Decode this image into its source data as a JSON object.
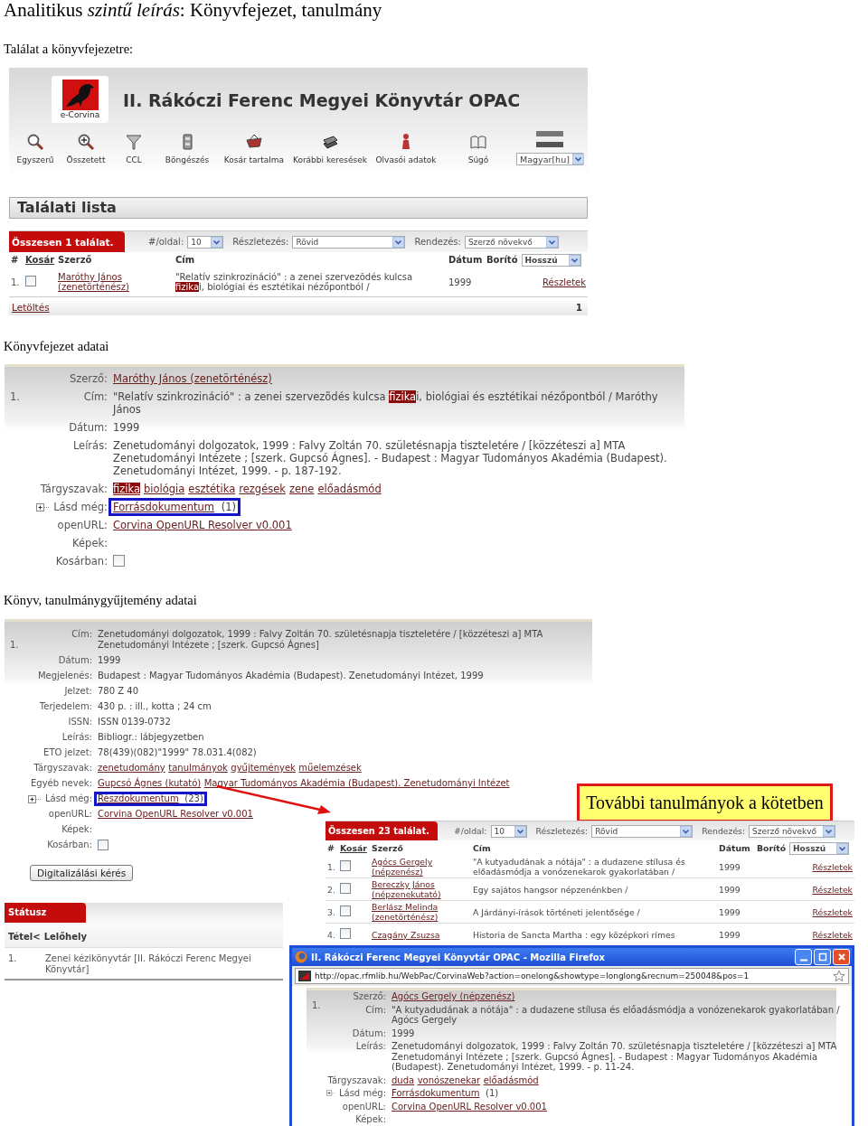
{
  "heading": "Analitikus *szintű leírás*: Könyvfejezet, tanulmány",
  "caption_1": "Találat a könyvfejezetre:",
  "opac": {
    "logo_text": "e-Corvina",
    "title": "II. Rákóczi Ferenc Megyei Könyvtár OPAC",
    "nav": [
      {
        "label": "Egyszerű"
      },
      {
        "label": "Összetett"
      },
      {
        "label": "CCL"
      },
      {
        "label": "Böngészés"
      },
      {
        "label": "Kosár tartalma"
      },
      {
        "label": "Korábbi keresések"
      },
      {
        "label": "Olvasói adatok"
      },
      {
        "label": "Súgó"
      }
    ],
    "language": "Magyar[hu]",
    "results_title": "Találati lista"
  },
  "results_1": {
    "summary": "Összesen 1 találat.",
    "per_page_label": "#/oldal:",
    "per_page": "10",
    "detail_label": "Részletezés:",
    "detail": "Rövid",
    "sort_label": "Rendezés:",
    "sort": "Szerző növekvő",
    "columns": [
      {
        "label": "#",
        "link": false
      },
      {
        "label": "Kosár",
        "link": true
      },
      {
        "label": "Szerző",
        "link": false
      },
      {
        "label": "Cím",
        "link": false
      },
      {
        "label": "Dátum",
        "link": false
      },
      {
        "label": "Borító",
        "link": false
      }
    ],
    "cover": "Hosszú",
    "rows": [
      {
        "number": "1.",
        "checked": false,
        "author": "Maróthy János (zenetörténész)",
        "title": [
          {
            "text": "\"Relatív szinkrozináció\" : a zenei szervezõdés kulcsa ",
            "highlight": false
          },
          {
            "text": "fizika",
            "highlight": true
          },
          {
            "text": "i, biológiai és esztétikai nézőpontból /",
            "highlight": false
          }
        ],
        "date": "1999",
        "details": "Részletek"
      }
    ],
    "footer": {
      "download": "Letöltés",
      "page": "1"
    }
  },
  "caption_2": "Könyvfejezet adatai",
  "record_1": {
    "number": "1.",
    "fields": [
      {
        "label": "Szerző:",
        "kind": "link",
        "value": "Maróthy János (zenetörténész)"
      },
      {
        "label": "Cím:",
        "kind": "segments",
        "segments": [
          {
            "text": "\"Relatív szinkrozináció\" : a zenei szervezõdés kulcsa ",
            "highlight": false
          },
          {
            "text": "fizika",
            "highlight": true
          },
          {
            "text": "i, biológiai és esztétikai nézőpontból / Maróthy János",
            "highlight": false
          }
        ]
      },
      {
        "label": "Dátum:",
        "kind": "text",
        "value": "1999"
      },
      {
        "label": "Leírás:",
        "kind": "text",
        "value": "Zenetudományi dolgozatok, 1999 : Falvy Zoltán 70. születésnapja tiszteletére / [közzéteszi a] MTA Zenetudományi Intézete ; [szerk. Gupcsó Ágnes]. - Budapest : Magyar Tudományos Akadémia (Budapest). Zenetudományi Intézet, 1999. - p. 187-192."
      },
      {
        "label": "Tárgyszavak:",
        "kind": "links",
        "items": [
          {
            "text": "fizika",
            "highlight": true
          },
          {
            "text": "biológia",
            "highlight": false
          },
          {
            "text": "esztétika",
            "highlight": false
          },
          {
            "text": "rezgések",
            "highlight": false
          },
          {
            "text": "zene",
            "highlight": false
          },
          {
            "text": "előadásmód",
            "highlight": false
          }
        ]
      },
      {
        "label": "Lásd még:",
        "kind": "link",
        "value": "Forrásdokumentum",
        "suffix": "(1)",
        "expanded": false,
        "annotated": true
      },
      {
        "label": "openURL:",
        "kind": "link",
        "value": "Corvina OpenURL Resolver v0.001"
      },
      {
        "label": "Képek:",
        "kind": "empty"
      },
      {
        "label": "Kosárban:",
        "kind": "checkbox",
        "checked": false
      }
    ]
  },
  "caption_3": "Könyv, tanulmánygyűjtemény adatai",
  "record_2": {
    "number": "1.",
    "fields": [
      {
        "label": "Cím:",
        "kind": "text",
        "value": "Zenetudományi dolgozatok, 1999 : Falvy Zoltán 70. születésnapja tiszteletére / [közzéteszi a] MTA Zenetudományi Intézete ; [szerk. Gupcsó Ágnes]"
      },
      {
        "label": "Dátum:",
        "kind": "text",
        "value": "1999"
      },
      {
        "label": "Megjelenés:",
        "kind": "text",
        "value": "Budapest : Magyar Tudományos Akadémia (Budapest). Zenetudományi Intézet, 1999"
      },
      {
        "label": "Jelzet:",
        "kind": "text",
        "value": "780 Z 40"
      },
      {
        "label": "Terjedelem:",
        "kind": "text",
        "value": "430 p. : ill., kotta ; 24 cm"
      },
      {
        "label": "ISSN:",
        "kind": "text",
        "value": "ISSN 0139-0732"
      },
      {
        "label": "Leírás:",
        "kind": "text",
        "value": "Bibliogr.: lábjegyzetben"
      },
      {
        "label": "ETO jelzet:",
        "kind": "text",
        "value": "78(439)(082)\"1999\" 78.031.4(082)"
      },
      {
        "label": "Tárgyszavak:",
        "kind": "links",
        "items": [
          {
            "text": "zenetudomány",
            "highlight": false
          },
          {
            "text": "tanulmányok",
            "highlight": false
          },
          {
            "text": "gyűjtemények",
            "highlight": false
          },
          {
            "text": "műelemzések",
            "highlight": false
          }
        ]
      },
      {
        "label": "Egyéb nevek:",
        "kind": "links",
        "items": [
          {
            "text": "Gupcsó Ágnes (kutató)",
            "highlight": false
          },
          {
            "text": "Magyar Tudományos Akadémia (Budapest). Zenetudományi Intézet",
            "highlight": false
          }
        ]
      },
      {
        "label": "Lásd még:",
        "kind": "link",
        "value": "Részdokumentum",
        "suffix": "(23)",
        "expanded": false,
        "annotated": true
      },
      {
        "label": "openURL:",
        "kind": "link",
        "value": "Corvina OpenURL Resolver v0.001"
      },
      {
        "label": "Képek:",
        "kind": "empty"
      },
      {
        "label": "Kosárban:",
        "kind": "checkbox",
        "checked": false
      }
    ]
  },
  "digitize_button": "Digitalizálási kérés",
  "status": {
    "tab": "Státusz",
    "columns": [
      "Tétel<",
      "Lelőhely"
    ],
    "rows": [
      {
        "item": "1.",
        "location": "Zenei kézikönyvtár [II. Rákóczi Ferenc Megyei Könyvtár]"
      }
    ]
  },
  "callout": "További tanulmányok a kötetben",
  "results_2": {
    "summary": "Összesen 23 találat.",
    "per_page_label": "#/oldal:",
    "per_page": "10",
    "detail_label": "Részletezés:",
    "detail": "Rövid",
    "sort_label": "Rendezés:",
    "sort": "Szerző növekvő",
    "columns": [
      {
        "label": "#",
        "link": false
      },
      {
        "label": "Kosár",
        "link": true
      },
      {
        "label": "Szerző",
        "link": false
      },
      {
        "label": "Cím",
        "link": false
      },
      {
        "label": "Dátum",
        "link": false
      },
      {
        "label": "Borító",
        "link": false
      }
    ],
    "cover": "Hosszú",
    "rows": [
      {
        "number": "1.",
        "checked": false,
        "author": "Agócs Gergely (népzenész)",
        "title": [
          {
            "text": "\"A kutyadudának a nótája\" : a dudazene stílusa és előadásmódja a vonózenekarok gyakorlatában /",
            "highlight": false
          }
        ],
        "date": "1999",
        "details": "Részletek"
      },
      {
        "number": "2.",
        "checked": false,
        "author": "Bereczky János (népzenekutató)",
        "title": [
          {
            "text": "Egy sajátos hangsor népzenénkben /",
            "highlight": false
          }
        ],
        "date": "1999",
        "details": "Részletek"
      },
      {
        "number": "3.",
        "checked": false,
        "author": "Berlász Melinda (zenetörténész)",
        "title": [
          {
            "text": "A Járdányi-írások történeti jelentősége /",
            "highlight": false
          }
        ],
        "date": "1999",
        "details": "Részletek"
      },
      {
        "number": "4.",
        "checked": false,
        "author": "Czagány Zsuzsa",
        "title": [
          {
            "text": "Historia de Sancta Martha : egy középkori rímes",
            "highlight": false
          }
        ],
        "date": "1999",
        "details": "Részletek"
      }
    ]
  },
  "browser": {
    "title": "II. Rákóczi Ferenc Megyei Könyvtár OPAC - Mozilla Firefox",
    "url": "http://opac.rfmlib.hu/WebPac/CorvinaWeb?action=onelong&showtype=longlong&recnum=250048&pos=1",
    "record": {
      "number": "1.",
      "fields": [
        {
          "label": "Szerző:",
          "kind": "link",
          "value": "Agócs Gergely (népzenész)"
        },
        {
          "label": "Cím:",
          "kind": "text",
          "value": "\"A kutyadudának a nótája\" : a dudazene stílusa és előadásmódja a vonózenekarok gyakorlatában / Agócs Gergely"
        },
        {
          "label": "Dátum:",
          "kind": "text",
          "value": "1999"
        },
        {
          "label": "Leírás:",
          "kind": "text",
          "value": "Zenetudományi dolgozatok, 1999 : Falvy Zoltán 70. születésnapja tiszteletére / [közzéteszi a] MTA Zenetudományi Intézete ; [szerk. Gupcsó Ágnes]. - Budapest : Magyar Tudományos Akadémia (Budapest). Zenetudományi Intézet, 1999. - p. 11-24."
        },
        {
          "label": "Tárgyszavak:",
          "kind": "links",
          "items": [
            {
              "text": "duda",
              "highlight": false
            },
            {
              "text": "vonószenekar",
              "highlight": false
            },
            {
              "text": "előadásmód",
              "highlight": false
            }
          ]
        },
        {
          "label": "Lásd még:",
          "kind": "link",
          "value": "Forrásdokumentum",
          "suffix": "(1)",
          "expanded": false
        },
        {
          "label": "openURL:",
          "kind": "link",
          "value": "Corvina OpenURL Resolver v0.001"
        },
        {
          "label": "Képek:",
          "kind": "empty"
        }
      ]
    }
  }
}
